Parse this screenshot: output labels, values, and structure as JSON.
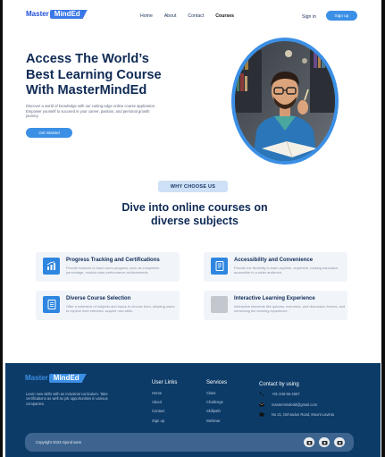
{
  "header": {
    "logo": {
      "part1": "Master",
      "part2": "MindEd"
    },
    "nav": [
      "Home",
      "About",
      "Contact",
      "Courses"
    ],
    "active_nav": "Courses",
    "signin": "Sign in",
    "signup": "Sign up"
  },
  "hero": {
    "title": "Access  The World’s\nBest Learning Course\nWith MasterMindEd",
    "description": "Discover a world of knowledge with our cutting-edge online course application. Empower yourself to succeed in your career, passion, and personal growth journey.",
    "cta": "Get Started",
    "image_icon": "student-studying-photo"
  },
  "why": {
    "badge": "WHY CHOOSE US",
    "title": "Dive into online courses on\ndiverse subjects"
  },
  "features": [
    {
      "title": "Progress Tracking and Certifications",
      "desc": "Provide features to track users progress, such as completion percentage, module-wise performance achievements.",
      "icon": "chart-icon"
    },
    {
      "title": "Accessibility and Convenience",
      "desc": "Provide the flexibility to learn anytime, anywhere, making education accessible to a wider audience.",
      "icon": "document-icon"
    },
    {
      "title": "Diverse Course Selection",
      "desc": "Offer a extensive of subjects and topics to choose from, allowing users to explore their interests, acquire new skills.",
      "icon": "list-icon"
    },
    {
      "title": "Interactive Learning Experience",
      "desc": "Interactive elements like quizzes, exercises, and discussion forums, and enhancing the learning experience.",
      "icon": "placeholder-icon"
    }
  ],
  "footer": {
    "logo": {
      "part1": "Master",
      "part2": "MindEd"
    },
    "description": "Learn new skills with an industrial curriculum. Take certifications as well as job opportunities in various companies.",
    "user_links": {
      "heading": "User Links",
      "items": [
        "Home",
        "About",
        "Contact",
        "Sign up"
      ]
    },
    "services": {
      "heading": "Services",
      "items": [
        "Class",
        "Challenge",
        "Skillpath",
        "Webinar"
      ]
    },
    "contact": {
      "heading": "Contact by  using",
      "phone": "+91-346-56-4567",
      "email": "mastermindedd@gmail.com",
      "address": "No 21, Dehradun Road, Mount Lavinia"
    },
    "copyright": "Copyright 2023 mjond sans",
    "social_icons": [
      "social-icon-1",
      "social-icon-2",
      "social-icon-3"
    ]
  }
}
